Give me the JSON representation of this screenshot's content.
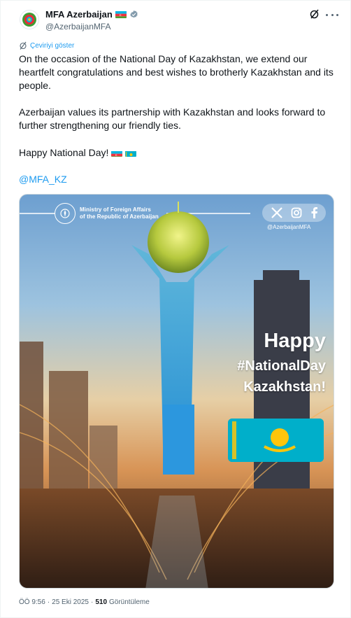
{
  "account": {
    "name": "MFA Azerbaijan",
    "handle": "@AzerbaijanMFA",
    "avatar_icon": "azerbaijan-emblem-icon",
    "verified_color": "#829aab"
  },
  "translate": {
    "label": "Çeviriyi göster"
  },
  "tweet": {
    "paragraph1": "On the occasion of the National Day of Kazakhstan, we extend our heartfelt congratulations and best wishes to brotherly Kazakhstan and its people.",
    "paragraph2": "Azerbaijan values its partnership with Kazakhstan and looks forward to further strengthening our friendly ties.",
    "paragraph3": "Happy National Day!",
    "mention": "@MFA_KZ"
  },
  "media": {
    "ministry_line1": "Ministry of Foreign Affairs",
    "ministry_line2": "of the Republic of Azerbaijan",
    "social_handle": "@AzerbaijanMFA",
    "happy": "Happy",
    "hashtag": "#NationalDay",
    "country": "Kazakhstan!"
  },
  "footer": {
    "time": "ÖÖ 9:56",
    "date": "25 Eki 2025",
    "separator": "·",
    "views": "510",
    "views_label": "Görüntüleme"
  },
  "colors": {
    "link": "#1d9bf0",
    "secondary_text": "#536471",
    "kz_blue": "#00afca",
    "kz_gold": "#fec50c"
  }
}
